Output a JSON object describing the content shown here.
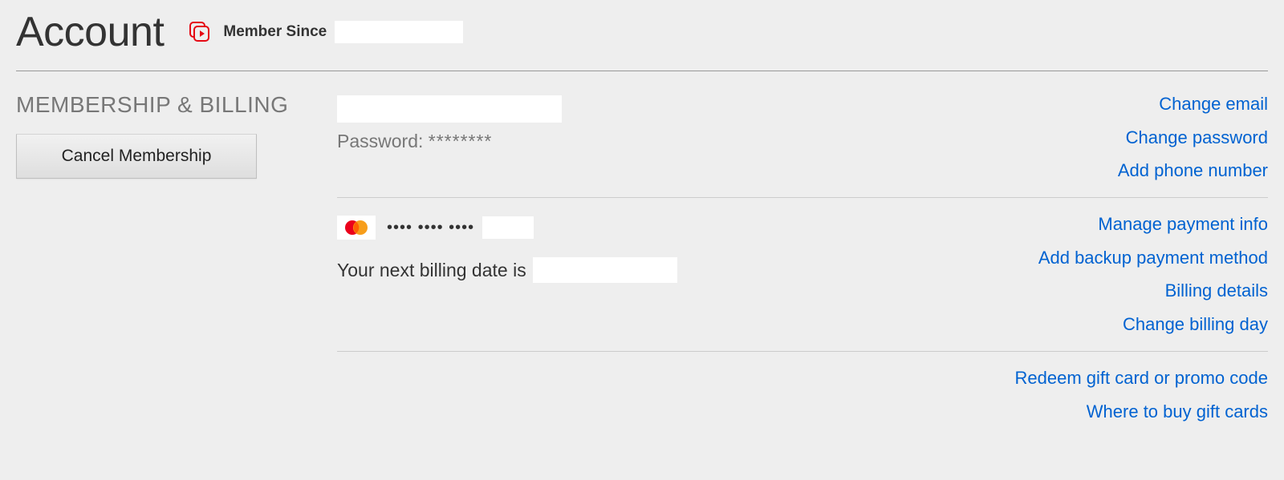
{
  "header": {
    "title": "Account",
    "member_since_label": "Member Since",
    "member_since_value": ""
  },
  "membership": {
    "section_title": "MEMBERSHIP & BILLING",
    "cancel_button": "Cancel Membership",
    "email_value": "",
    "password_label": "Password:",
    "password_mask": "********",
    "card_mask": "•••• •••• ••••",
    "card_last4": "",
    "billing_date_label": "Your next billing date is",
    "billing_date_value": "",
    "links": {
      "change_email": "Change email",
      "change_password": "Change password",
      "add_phone": "Add phone number",
      "manage_payment": "Manage payment info",
      "add_backup_payment": "Add backup payment method",
      "billing_details": "Billing details",
      "change_billing_day": "Change billing day",
      "redeem_gift": "Redeem gift card or promo code",
      "where_buy_gift": "Where to buy gift cards"
    }
  },
  "colors": {
    "link": "#0062d1",
    "brand": "#e50914"
  }
}
